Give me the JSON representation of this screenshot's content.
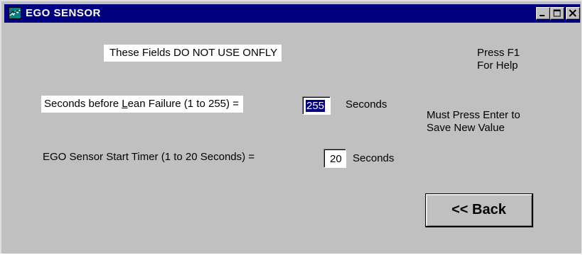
{
  "window": {
    "title": "EGO SENSOR",
    "icon": "ego-sensor-app-icon",
    "controls": [
      "minimize-icon",
      "maximize-icon",
      "close-icon"
    ]
  },
  "notice": "These Fields DO NOT USE ONFLY",
  "help": {
    "line1": "Press F1",
    "line2": "For Help"
  },
  "lean_failure": {
    "label_pre": "Seconds before ",
    "label_hotkey": "L",
    "label_post": "ean Failure (1 to 255) =",
    "value": "255",
    "unit": "Seconds"
  },
  "enter_hint": {
    "line1": "Must Press Enter to",
    "line2": "Save New Value"
  },
  "start_timer": {
    "label": "EGO Sensor Start Timer (1 to 20 Seconds) =",
    "value": "20",
    "unit": "Seconds"
  },
  "back_button": {
    "label": "<< Back"
  },
  "colors": {
    "titlebar": "#000080",
    "face": "#c0c0c0",
    "selection": "#000080"
  }
}
